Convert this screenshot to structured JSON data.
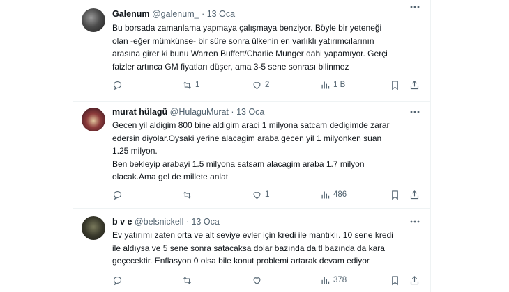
{
  "colors": {
    "text": "#0f1419",
    "muted": "#536471",
    "border": "#eff3f4"
  },
  "tweets": [
    {
      "name": "Galenum",
      "handle": "@galenum_",
      "dot": "·",
      "date": "13 Oca",
      "lines": [
        "Bu borsada zamanlama yapmaya çalışmaya benziyor. Böyle bir yeteneği",
        "olan -eğer mümkünse- bir süre sonra ülkenin en varlıklı yatırımcılarının",
        "arasına girer ki bunu Warren Buffett/Charlie Munger dahi yapamıyor. Gerçi",
        "faizler artınca GM fiyatları düşer, ama 3-5 sene sonrası bilinmez"
      ],
      "retweets": "1",
      "likes": "2",
      "views": "1 B"
    },
    {
      "name": "murat hülagü",
      "handle": "@HulaguMurat",
      "dot": "·",
      "date": "13 Oca",
      "lines": [
        "Gecen yil aldigim 800 bine aldigim araci 1 milyona satcam dedigimde zarar",
        "edersin diyolar.Oysaki yerine alacagim araba gecen yil 1 milyonken suan",
        "1.25 milyon.",
        "Ben bekleyip arabayi 1.5 milyona satsam alacagim araba 1.7 milyon",
        "olacak.Ama gel de millete anlat"
      ],
      "retweets": "",
      "likes": "1",
      "views": "486"
    },
    {
      "name": "b v e",
      "handle": "@belsnickell",
      "dot": "·",
      "date": "13 Oca",
      "lines": [
        "Ev yatırımı zaten orta ve alt seviye evler için kredi ile mantıklı. 10 sene kredi",
        "ile aldıysa ve 5 sene sonra satacaksa dolar bazında da tl bazında da kara",
        "geçecektir. Enflasyon 0 olsa bile konut problemi artarak devam ediyor"
      ],
      "retweets": "",
      "likes": "",
      "views": "378"
    }
  ],
  "icons": [
    "reply-icon",
    "retweet-icon",
    "like-icon",
    "views-icon",
    "bookmark-icon",
    "share-icon",
    "more-icon"
  ]
}
